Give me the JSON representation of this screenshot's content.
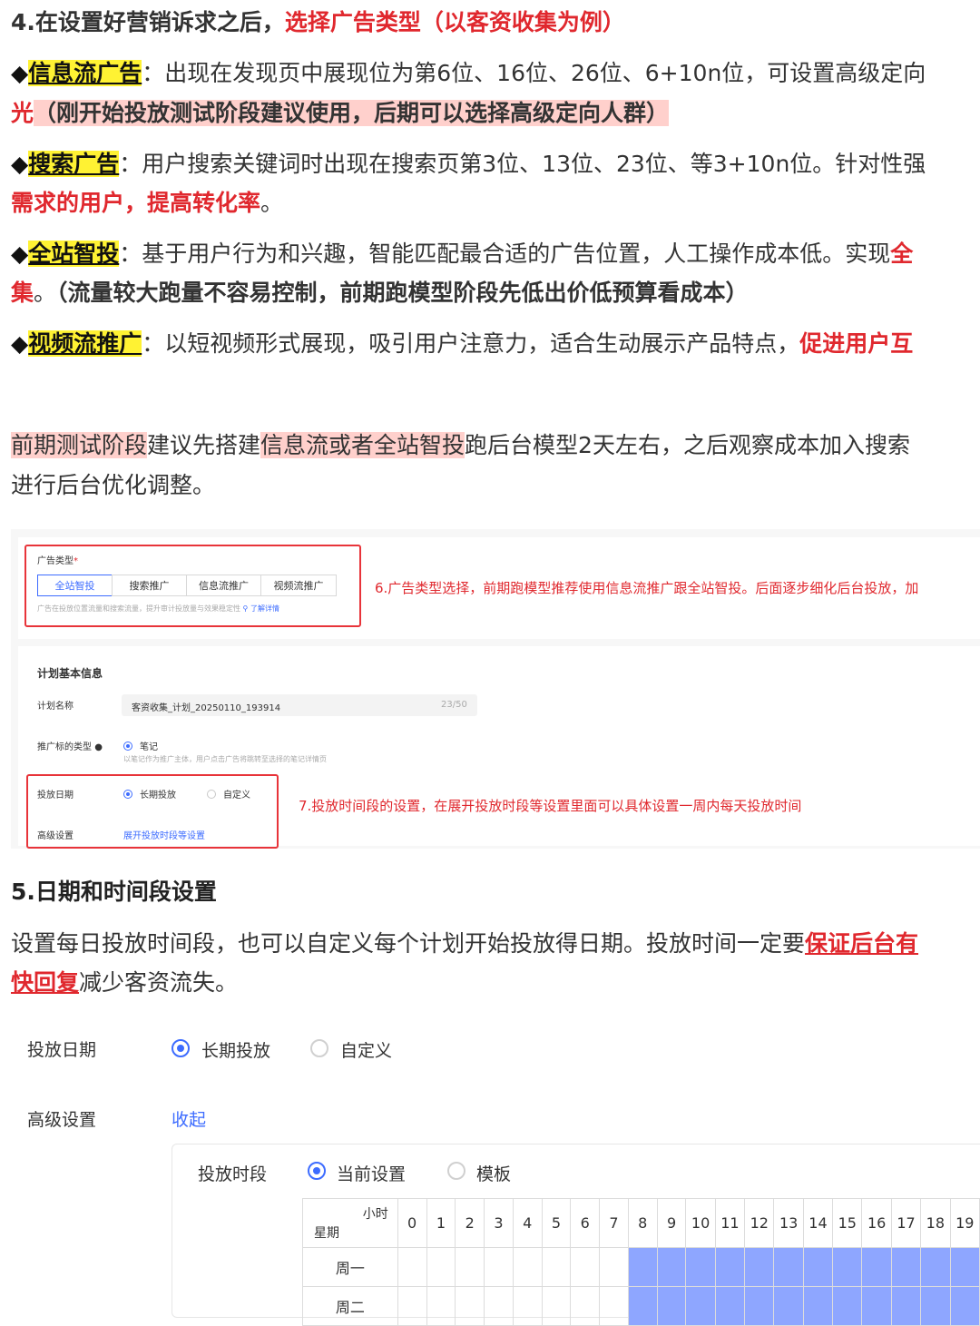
{
  "section4": {
    "heading_prefix": "4.在设置好营销诉求之后，",
    "heading_red": "选择广告类型（以客资收集为例）",
    "feed": {
      "bullet": "◆",
      "name": "信息流广告",
      "text": "：出现在发现页中展现位为第6位、16位、26位、6+10n位，可设置高级定向",
      "line2_red": "光",
      "line2_pink": "（刚开始投放测试阶段建议使用，后期可以选择高级定向人群）"
    },
    "search": {
      "bullet": "◆",
      "name": "搜索广告",
      "text": "：用户搜索关键词时出现在搜索页第3位、13位、23位、等3+10n位。针对性强",
      "line2_red": "需求的用户，提高转化率",
      "line2_end": "。"
    },
    "allsite": {
      "bullet": "◆",
      "name": "全站智投",
      "text": "：基于用户行为和兴趣，智能匹配最合适的广告位置，人工操作成本低。实现",
      "text_red": "全",
      "line2_red": "集",
      "line2_mid": "。",
      "line2_bold": "（流量较大跑量不容易控制，前期跑模型阶段先低出价低预算看成本）"
    },
    "video": {
      "bullet": "◆",
      "name": "视频流推广",
      "text": "：以短视频形式展现，吸引用户注意力，适合生动展示产品特点，",
      "text_red": "促进用户互"
    }
  },
  "advice": {
    "p1": "前期测试阶段",
    "t1": "建议先搭建",
    "p2": "信息流或者全站智投",
    "t2": "跑后台模型2天左右，之后观察成本加入搜索",
    "line2": "进行后台优化调整。"
  },
  "screenshot1": {
    "ad_type_label": "广告类型",
    "required_mark": "*",
    "tabs": [
      "全站智投",
      "搜索推广",
      "信息流推广",
      "视频流推广"
    ],
    "hint": "广告在投放位置流量和搜索流量，提升审计投放量与效果稳定性",
    "learn_more": "了解详情",
    "note6": "6.广告类型选择，前期跑模型推荐使用信息流推广跟全站智投。后面逐步细化后台投放，加"
  },
  "screenshot2": {
    "section_title": "计划基本信息",
    "plan_name_label": "计划名称",
    "plan_name_value": "客资收集_计划_20250110_193914",
    "plan_name_count": "23/50",
    "target_type_label": "推广标的类型",
    "target_type_option": "笔记",
    "target_type_hint": "以笔记作为推广主体，用户点击广告将跳转至选择的笔记详情页",
    "date_label": "投放日期",
    "date_opt1": "长期投放",
    "date_opt2": "自定义",
    "advanced_label": "高级设置",
    "advanced_link": "展开投放时段等设置",
    "note7": "7.投放时间段的设置，在展开投放时段等设置里面可以具体设置一周内每天投放时间"
  },
  "section5": {
    "heading": "5.日期和时间段设置",
    "text": "设置每日投放时间段，也可以自定义每个计划开始投放得日期。投放时间一定要",
    "text_red": "保证后台有",
    "line2_red": "快回复",
    "line2": "减少客资流失。"
  },
  "form": {
    "date_label": "投放日期",
    "date_opt1": "长期投放",
    "date_opt2": "自定义",
    "advanced_label": "高级设置",
    "collapse": "收起",
    "period_label": "投放时段",
    "period_opt1": "当前设置",
    "period_opt2": "模板",
    "hour_label": "小时",
    "week_label": "星期",
    "hours": [
      "0",
      "1",
      "2",
      "3",
      "4",
      "5",
      "6",
      "7",
      "8",
      "9",
      "10",
      "11",
      "12",
      "13",
      "14",
      "15",
      "16",
      "17",
      "18",
      "19"
    ],
    "days": [
      "周一",
      "周二"
    ],
    "filled_from_hour": 8
  }
}
